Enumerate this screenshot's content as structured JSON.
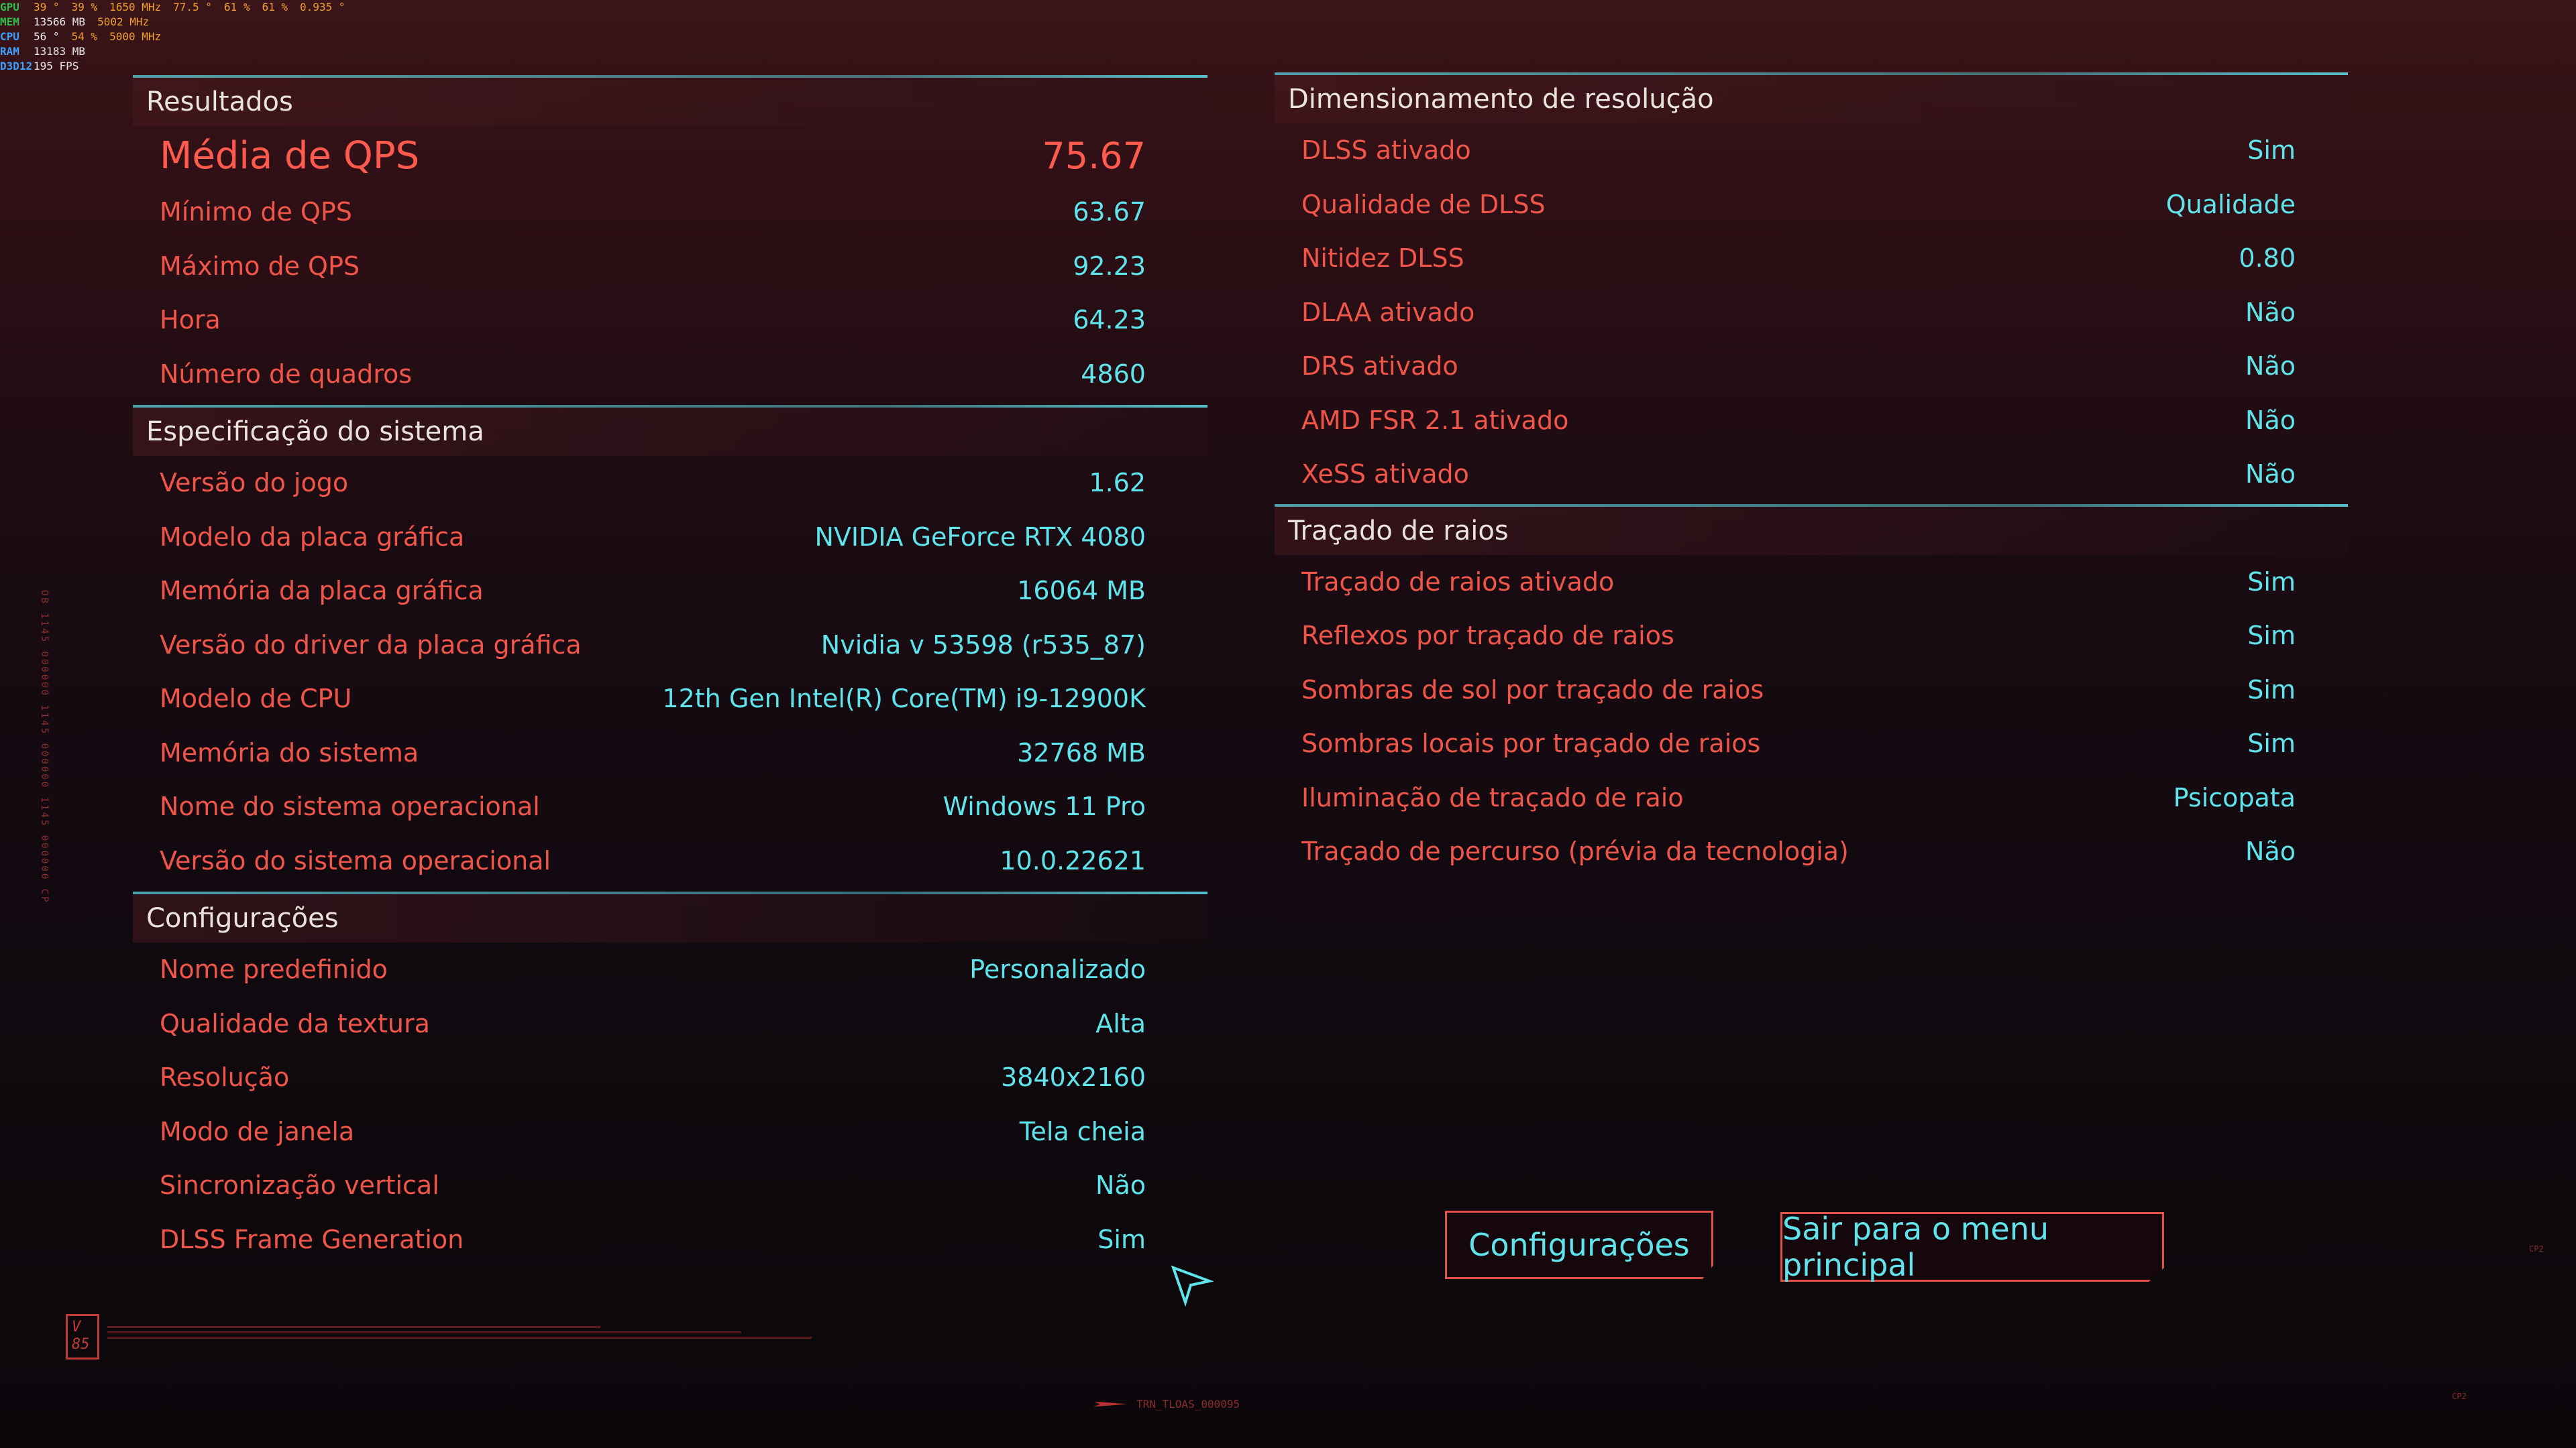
{
  "overlay": {
    "rows": [
      {
        "label": "GPU",
        "label_color": "#2fbf4a",
        "values": [
          "39 °",
          "39 %",
          "1650 MHz",
          "77.5 °",
          "61 %",
          "61 %",
          "0.935 °"
        ]
      },
      {
        "label": "MEM",
        "label_color": "#2fbf4a",
        "values": [
          "13566 MB",
          "5002 MHz"
        ]
      },
      {
        "label": "CPU",
        "label_color": "#3aa0ff",
        "values": [
          "56 °",
          "54 %",
          "5000 MHz"
        ]
      },
      {
        "label": "RAM",
        "label_color": "#3aa0ff",
        "values": [
          "13183 MB"
        ]
      },
      {
        "label": "D3D12",
        "label_color": "#3aa0ff",
        "values": [
          "195 FPS"
        ]
      }
    ]
  },
  "results": {
    "title": "Resultados",
    "avg": {
      "label": "Média de QPS",
      "value": "75.67"
    },
    "rows": [
      {
        "label": "Mínimo de QPS",
        "value": "63.67"
      },
      {
        "label": "Máximo de QPS",
        "value": "92.23"
      },
      {
        "label": "Hora",
        "value": "64.23"
      },
      {
        "label": "Número de quadros",
        "value": "4860"
      }
    ]
  },
  "system": {
    "title": "Especificação do sistema",
    "rows": [
      {
        "label": "Versão do jogo",
        "value": "1.62"
      },
      {
        "label": "Modelo da placa gráfica",
        "value": "NVIDIA GeForce RTX 4080"
      },
      {
        "label": "Memória da placa gráfica",
        "value": "16064 MB"
      },
      {
        "label": "Versão do driver da placa gráfica",
        "value": "Nvidia v 53598 (r535_87)"
      },
      {
        "label": "Modelo de CPU",
        "value": "12th Gen Intel(R) Core(TM) i9-12900K"
      },
      {
        "label": "Memória do sistema",
        "value": "32768 MB"
      },
      {
        "label": "Nome do sistema operacional",
        "value": "Windows 11 Pro"
      },
      {
        "label": "Versão do sistema operacional",
        "value": "10.0.22621"
      }
    ]
  },
  "settings": {
    "title": "Configurações",
    "rows": [
      {
        "label": "Nome predefinido",
        "value": "Personalizado"
      },
      {
        "label": "Qualidade da textura",
        "value": "Alta"
      },
      {
        "label": "Resolução",
        "value": "3840x2160"
      },
      {
        "label": "Modo de janela",
        "value": "Tela cheia"
      },
      {
        "label": "Sincronização vertical",
        "value": "Não"
      },
      {
        "label": "DLSS Frame Generation",
        "value": "Sim"
      }
    ]
  },
  "scaling": {
    "title": "Dimensionamento de resolução",
    "rows": [
      {
        "label": "DLSS ativado",
        "value": "Sim"
      },
      {
        "label": "Qualidade de DLSS",
        "value": "Qualidade"
      },
      {
        "label": "Nitidez DLSS",
        "value": "0.80"
      },
      {
        "label": "DLAA ativado",
        "value": "Não"
      },
      {
        "label": "DRS ativado",
        "value": "Não"
      },
      {
        "label": "AMD FSR 2.1 ativado",
        "value": "Não"
      },
      {
        "label": "XeSS ativado",
        "value": "Não"
      }
    ]
  },
  "raytracing": {
    "title": "Traçado de raios",
    "rows": [
      {
        "label": "Traçado de raios ativado",
        "value": "Sim"
      },
      {
        "label": "Reflexos por traçado de raios",
        "value": "Sim"
      },
      {
        "label": "Sombras de sol por traçado de raios",
        "value": "Sim"
      },
      {
        "label": "Sombras locais por traçado de raios",
        "value": "Sim"
      },
      {
        "label": "Iluminação de traçado de raio",
        "value": "Psicopata"
      },
      {
        "label": "Traçado de percurso (prévia da tecnologia)",
        "value": "Não"
      }
    ]
  },
  "buttons": {
    "settings": "Configurações",
    "exit": "Sair para o menu principal"
  },
  "decor": {
    "version_badge": "V 85",
    "footer_code": "TRN_TLOAS_000095",
    "vertical_text": "OB 1145 000000 1145 000000 1145 000000 CP",
    "corner_right": "CP2",
    "corner_bottom_right": "CP2",
    "accent_color": "#5fe4ec",
    "label_color": "#f0554a"
  }
}
